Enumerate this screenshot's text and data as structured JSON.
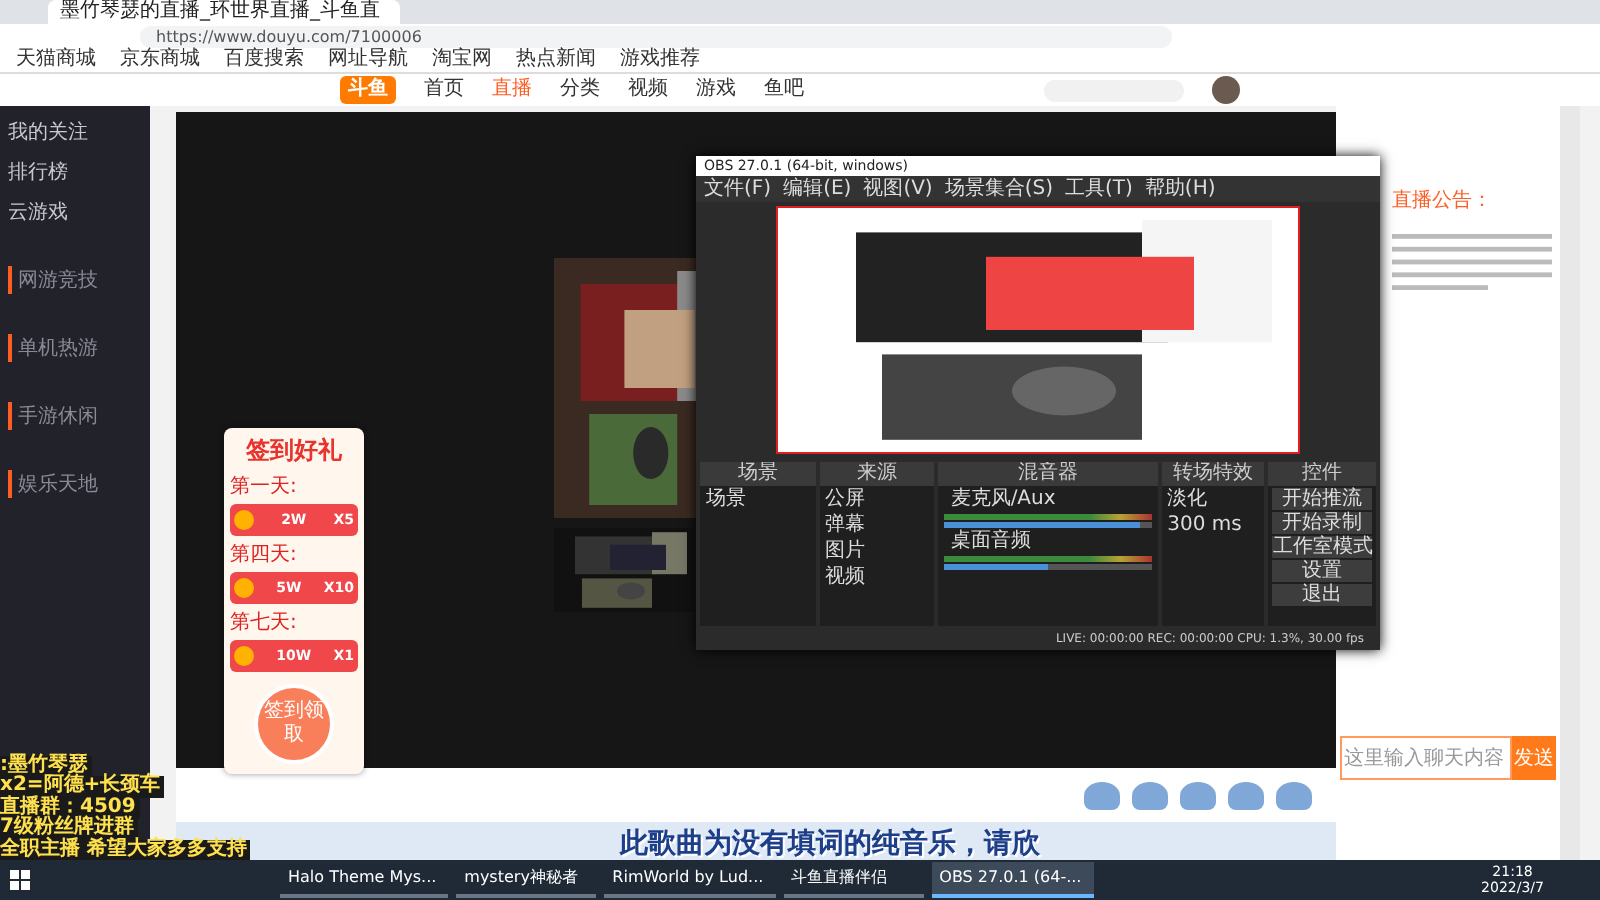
{
  "browser": {
    "tab_title": "墨竹琴瑟的直播_环世界直播_斗鱼直",
    "url": "https://www.douyu.com/7100006",
    "bookmarks": [
      "天猫商城",
      "京东商城",
      "百度搜索",
      "网址导航",
      "淘宝网",
      "热点新闻",
      "游戏推荐"
    ]
  },
  "site_header": {
    "logo": "斗鱼",
    "nav": [
      {
        "label": "首页",
        "selected": false
      },
      {
        "label": "直播",
        "selected": true
      },
      {
        "label": "分类",
        "selected": false
      },
      {
        "label": "视频",
        "selected": false
      },
      {
        "label": "游戏",
        "selected": false
      },
      {
        "label": "鱼吧",
        "selected": false
      }
    ]
  },
  "sidebar": {
    "items": [
      "我的关注",
      "排行榜",
      "云游戏"
    ],
    "sections": [
      "网游竞技",
      "单机热游",
      "手游休闲",
      "娱乐天地"
    ]
  },
  "sign_in_card": {
    "title": "签到好礼",
    "days": [
      {
        "label": "第一天:",
        "amount": "2W",
        "count": "X5"
      },
      {
        "label": "第四天:",
        "amount": "5W",
        "count": "X10"
      },
      {
        "label": "第七天:",
        "amount": "10W",
        "count": "X1"
      }
    ],
    "button": "签到领取"
  },
  "obs": {
    "title": "OBS 27.0.1 (64-bit, windows)",
    "menu": [
      "文件(F)",
      "编辑(E)",
      "视图(V)",
      "场景集合(S)",
      "工具(T)",
      "帮助(H)"
    ],
    "docks": [
      "场景",
      "来源",
      "混音器",
      "转场特效",
      "控件"
    ],
    "scenes": [
      "场景"
    ],
    "sources": [
      "公屏",
      "弹幕",
      "图片",
      "视频"
    ],
    "mixer": [
      {
        "name": "麦克风/Aux",
        "level": 0.95
      },
      {
        "name": "桌面音频",
        "level": 0.5
      }
    ],
    "transition": "淡化",
    "duration": "300 ms",
    "controls": [
      "开始推流",
      "开始录制",
      "工作室模式",
      "设置",
      "退出"
    ],
    "status": "LIVE: 00:00:00   REC: 00:00:00   CPU: 1.3%, 30.00 fps"
  },
  "chat": {
    "placeholder": "这里输入聊天内容",
    "send": "发送",
    "notice": "直播公告："
  },
  "overlay": {
    "lines": [
      ":墨竹琴瑟",
      "x2=阿德+长颈车",
      "直播群：4509",
      "7级粉丝牌进群",
      "全职主播 希望大家多多支持"
    ],
    "caption": "此歌曲为没有填词的纯音乐，请欣"
  },
  "taskbar": {
    "items": [
      {
        "label": "Halo Theme Mys...",
        "selected": false
      },
      {
        "label": "mystery神秘者",
        "selected": false
      },
      {
        "label": "RimWorld by Lud...",
        "selected": false
      },
      {
        "label": "斗鱼直播伴侣",
        "selected": false
      },
      {
        "label": "OBS 27.0.1 (64-...",
        "selected": true
      }
    ],
    "time": "21:18",
    "date": "2022/3/7"
  }
}
